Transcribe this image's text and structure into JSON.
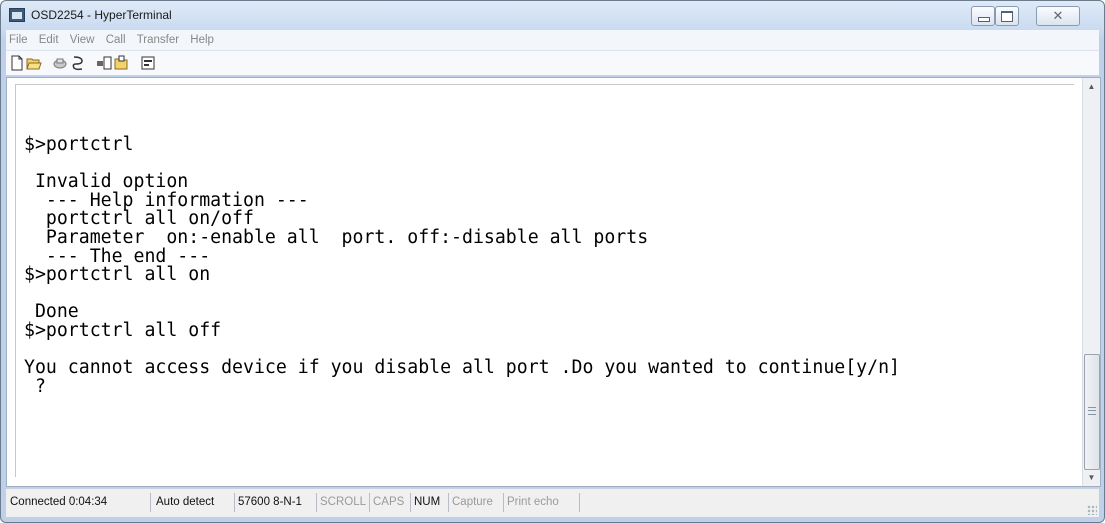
{
  "window": {
    "title": "OSD2254 - HyperTerminal",
    "controls": {
      "minimize": "minimize",
      "maximize": "maximize",
      "close": "✕"
    }
  },
  "menu": {
    "items": [
      "File",
      "Edit",
      "View",
      "Call",
      "Transfer",
      "Help"
    ]
  },
  "toolbar": {
    "icons": [
      "new-connection-icon",
      "open-icon",
      "call-icon",
      "disconnect-icon",
      "send-icon",
      "receive-icon",
      "properties-icon"
    ]
  },
  "terminal": {
    "lines": [
      "$>portctrl",
      "",
      " Invalid option",
      "  --- Help information ---",
      "  portctrl all on/off",
      "  Parameter  on:-enable all  port. off:-disable all ports",
      "  --- The end ---",
      "$>portctrl all on",
      "",
      " Done",
      "$>portctrl all off",
      "",
      "You cannot access device if you disable all port .Do you wanted to continue[y/n]",
      " ?"
    ]
  },
  "statusbar": {
    "connected": "Connected 0:04:34",
    "detect": "Auto detect",
    "settings": "57600 8-N-1",
    "scroll": "SCROLL",
    "caps": "CAPS",
    "num": "NUM",
    "capture": "Capture",
    "print_echo": "Print echo"
  },
  "colors": {
    "frame": "#bfd1ea",
    "terminal_bg": "#ffffff",
    "terminal_text": "#000000",
    "status_inactive": "#9a9a9a"
  }
}
